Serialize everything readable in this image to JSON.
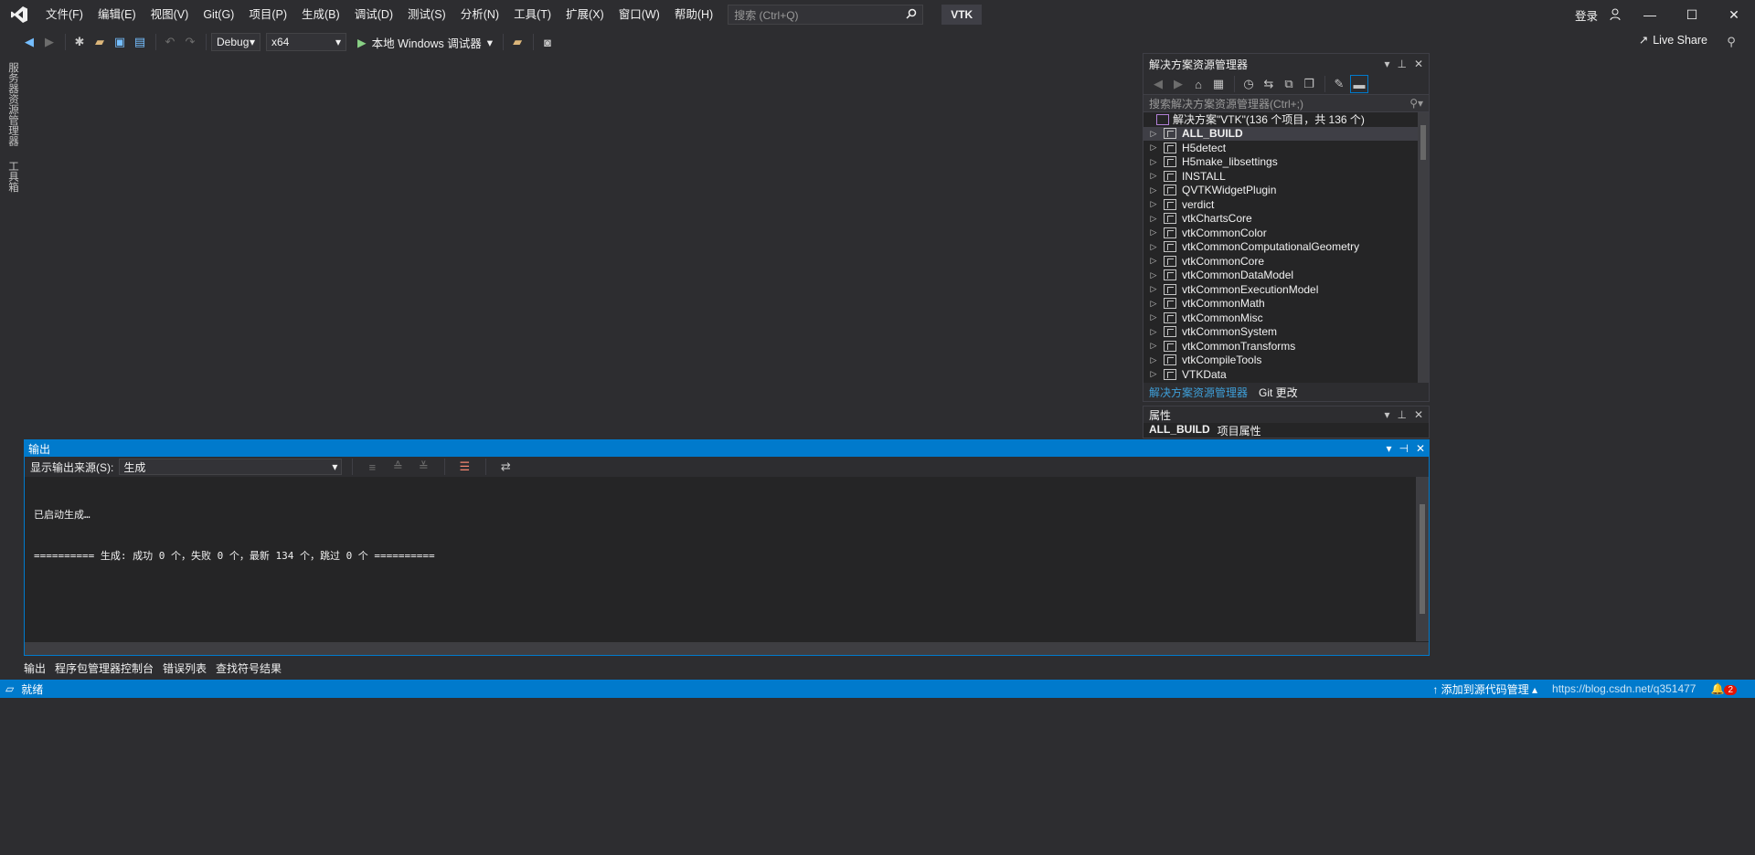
{
  "menu": [
    "文件(F)",
    "编辑(E)",
    "视图(V)",
    "Git(G)",
    "项目(P)",
    "生成(B)",
    "调试(D)",
    "测试(S)",
    "分析(N)",
    "工具(T)",
    "扩展(X)",
    "窗口(W)",
    "帮助(H)"
  ],
  "search": {
    "placeholder": "搜索 (Ctrl+Q)"
  },
  "solution_title": "VTK",
  "login": "登录",
  "toolbar": {
    "config": "Debug",
    "platform": "x64",
    "run_label": "本地 Windows 调试器",
    "live_share": "Live Share"
  },
  "left_tabs": [
    "服务器资源管理器",
    "工具箱"
  ],
  "solution_explorer": {
    "title": "解决方案资源管理器",
    "search_placeholder": "搜索解决方案资源管理器(Ctrl+;)",
    "root": "解决方案\"VTK\"(136 个项目，共 136 个)",
    "items": [
      "ALL_BUILD",
      "H5detect",
      "H5make_libsettings",
      "INSTALL",
      "QVTKWidgetPlugin",
      "verdict",
      "vtkChartsCore",
      "vtkCommonColor",
      "vtkCommonComputationalGeometry",
      "vtkCommonCore",
      "vtkCommonDataModel",
      "vtkCommonExecutionModel",
      "vtkCommonMath",
      "vtkCommonMisc",
      "vtkCommonSystem",
      "vtkCommonTransforms",
      "vtkCompileTools",
      "VTKData"
    ],
    "tabs": [
      "解决方案资源管理器",
      "Git 更改"
    ]
  },
  "properties": {
    "title": "属性",
    "object": "ALL_BUILD",
    "object_desc": "项目属性"
  },
  "output": {
    "title": "输出",
    "source_label": "显示输出来源(S):",
    "source_value": "生成",
    "lines": [
      "已启动生成…",
      "========== 生成: 成功 0 个，失败 0 个，最新 134 个，跳过 0 个 =========="
    ]
  },
  "bottom_tabs": [
    "输出",
    "程序包管理器控制台",
    "错误列表",
    "查找符号结果"
  ],
  "status": {
    "ready": "就绪",
    "source_control": "添加到源代码管理",
    "watermark": "https://blog.csdn.net/q351477",
    "notifications": "2"
  },
  "colors": {
    "accent": "#007acc",
    "bg": "#2d2d30",
    "panel": "#252526"
  }
}
